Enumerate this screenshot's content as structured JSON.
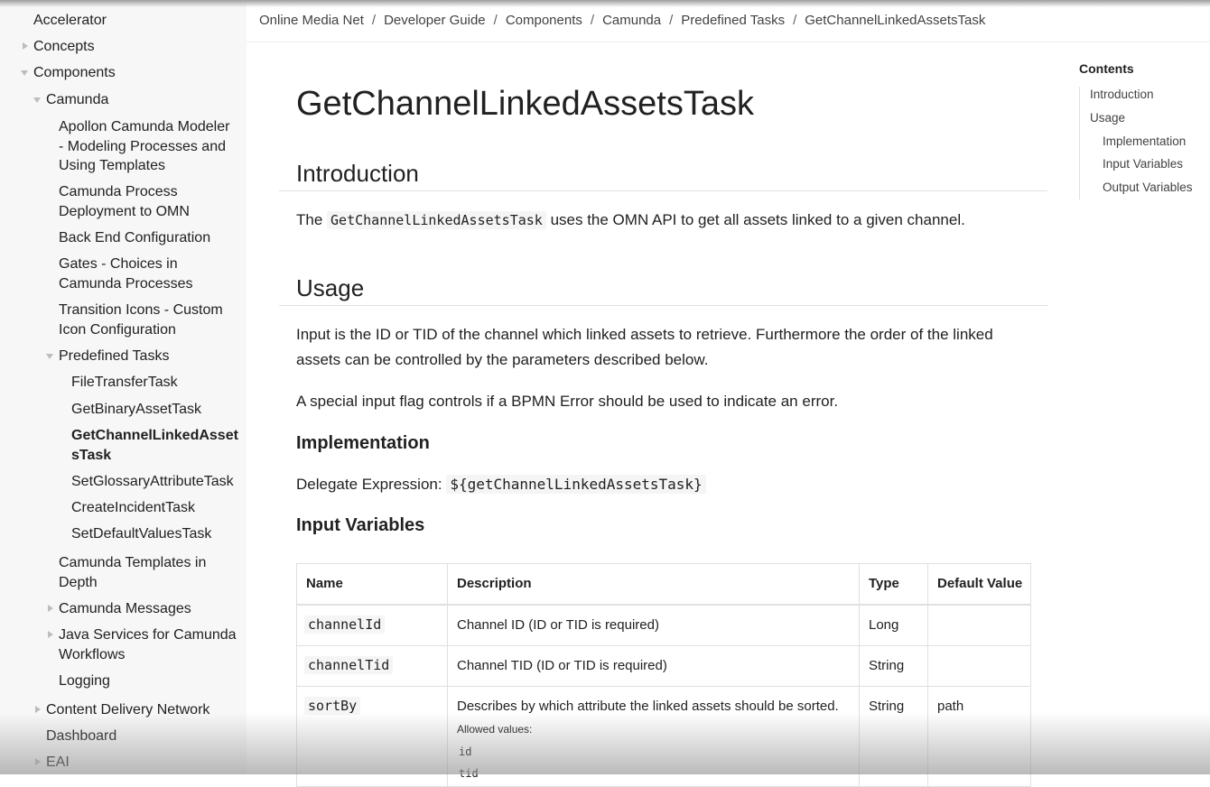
{
  "breadcrumb": [
    "Online Media Net",
    "Developer Guide",
    "Components",
    "Camunda",
    "Predefined Tasks",
    "GetChannelLinkedAssetsTask"
  ],
  "breadcrumb_separator": "/",
  "sidebar": {
    "items": [
      {
        "label": "Accelerator"
      },
      {
        "label": "Concepts"
      },
      {
        "label": "Components"
      },
      {
        "label": "Camunda"
      },
      {
        "label": "Apollon Camunda Modeler - Modeling Processes and Using Templates"
      },
      {
        "label": "Camunda Process Deployment to OMN"
      },
      {
        "label": "Back End Configuration"
      },
      {
        "label": "Gates - Choices in Camunda Processes"
      },
      {
        "label": "Transition Icons - Custom Icon Configuration"
      },
      {
        "label": "Predefined Tasks"
      },
      {
        "label": "FileTransferTask"
      },
      {
        "label": "GetBinaryAssetTask"
      },
      {
        "label": "GetChannelLinkedAssetsTask"
      },
      {
        "label": "SetGlossaryAttributeTask"
      },
      {
        "label": "CreateIncidentTask"
      },
      {
        "label": "SetDefaultValuesTask"
      },
      {
        "label": "Camunda Templates in Depth"
      },
      {
        "label": "Camunda Messages"
      },
      {
        "label": "Java Services for Camunda Workflows"
      },
      {
        "label": "Logging"
      },
      {
        "label": "Content Delivery Network"
      },
      {
        "label": "Dashboard"
      },
      {
        "label": "EAI"
      }
    ]
  },
  "main": {
    "title": "GetChannelLinkedAssetsTask",
    "intro_heading": "Introduction",
    "intro": {
      "pre": "The ",
      "code": "GetChannelLinkedAssetsTask",
      "post": " uses the OMN API to get all assets linked to a given channel."
    },
    "usage_heading": "Usage",
    "usage_p1": "Input is the ID or TID of the channel which linked assets to retrieve. Furthermore the order of the linked assets can be controlled by the parameters described below.",
    "usage_p2": "A special input flag controls if a BPMN Error should be used to indicate an error.",
    "implementation_heading": "Implementation",
    "delegate": {
      "label": "Delegate Expression: ",
      "code": "${getChannelLinkedAssetsTask}"
    },
    "input_heading": "Input Variables",
    "table": {
      "headers": [
        "Name",
        "Description",
        "Type",
        "Default Value"
      ],
      "rows": [
        {
          "name": "channelId",
          "description": "Channel ID (ID or TID is required)",
          "type": "Long",
          "default": ""
        },
        {
          "name": "channelTid",
          "description": "Channel TID (ID or TID is required)",
          "type": "String",
          "default": ""
        },
        {
          "name": "sortBy",
          "description": "Describes by which attribute the linked assets should be sorted.",
          "type": "String",
          "default": "path",
          "allowed_label": "Allowed values:",
          "allowed_values": [
            "id",
            "tid"
          ]
        }
      ]
    }
  },
  "toc": {
    "title": "Contents",
    "items": [
      "Introduction",
      "Usage",
      "Implementation",
      "Input Variables",
      "Output Variables"
    ]
  }
}
